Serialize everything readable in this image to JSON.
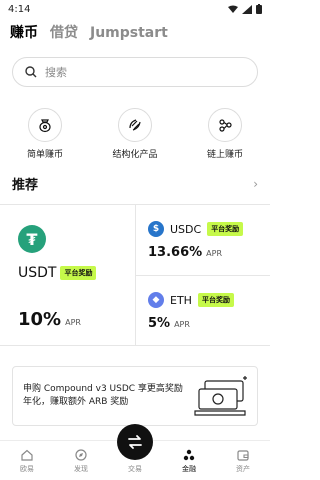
{
  "status": {
    "time": "4:14"
  },
  "tabs": [
    "赚币",
    "借贷",
    "Jumpstart"
  ],
  "search": {
    "placeholder": "搜索"
  },
  "quick_actions": [
    {
      "label": "简单赚币",
      "icon": "simple-earn-icon"
    },
    {
      "label": "结构化产品",
      "icon": "structured-products-icon"
    },
    {
      "label": "链上赚币",
      "icon": "onchain-earn-icon"
    }
  ],
  "recommend": {
    "title": "推荐"
  },
  "products": [
    {
      "coin": "USDT",
      "badge": "平台奖励",
      "rate": "10%",
      "apr_label": "APR",
      "color": "#26a17b"
    },
    {
      "coin": "USDC",
      "badge": "平台奖励",
      "rate": "13.66%",
      "apr_label": "APR",
      "color": "#2775ca"
    },
    {
      "coin": "ETH",
      "badge": "平台奖励",
      "rate": "5%",
      "apr_label": "APR",
      "color": "#627eea"
    }
  ],
  "banner": {
    "text": "申购 Compound v3 USDC 享更高奖励年化，赚取额外 ARB 奖励"
  },
  "nav": [
    {
      "label": "欧易"
    },
    {
      "label": "发现"
    },
    {
      "label": "交易"
    },
    {
      "label": "金融"
    },
    {
      "label": "资产"
    }
  ],
  "active_nav": "金融"
}
